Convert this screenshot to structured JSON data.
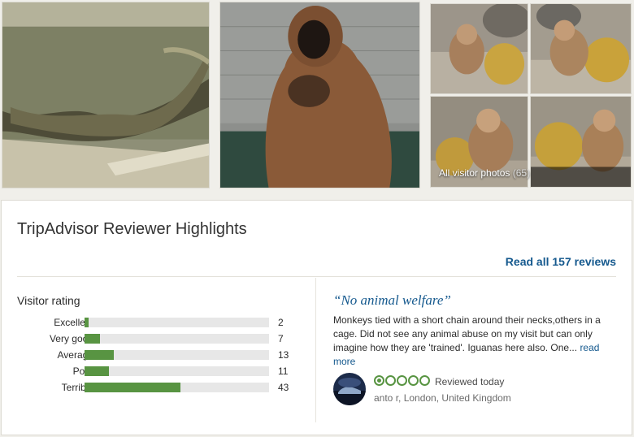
{
  "photos": {
    "all_label": "All visitor photos",
    "count": "(65)"
  },
  "highlights": {
    "title": "TripAdvisor Reviewer Highlights",
    "read_all": "Read all 157 reviews"
  },
  "visitor_rating": {
    "title": "Visitor rating",
    "rows": [
      {
        "label": "Excellent",
        "count": "2",
        "value": 2
      },
      {
        "label": "Very good",
        "count": "7",
        "value": 7
      },
      {
        "label": "Average",
        "count": "13",
        "value": 13
      },
      {
        "label": "Poor",
        "count": "11",
        "value": 11
      },
      {
        "label": "Terrible",
        "count": "43",
        "value": 43
      }
    ],
    "max": 83
  },
  "review": {
    "quote": "“No animal welfare”",
    "body": "Monkeys tied with a short chain around their necks,others in a cage. Did not see any animal abuse on my visit but can only imagine how they are 'trained'. Iguanas here also. One...",
    "read_more": "read more",
    "rating": 1,
    "rating_max": 5,
    "date_text": "Reviewed today",
    "reviewer": "anto r, London, United Kingdom"
  },
  "colors": {
    "bar_fill": "#589442",
    "link": "#15598e"
  }
}
